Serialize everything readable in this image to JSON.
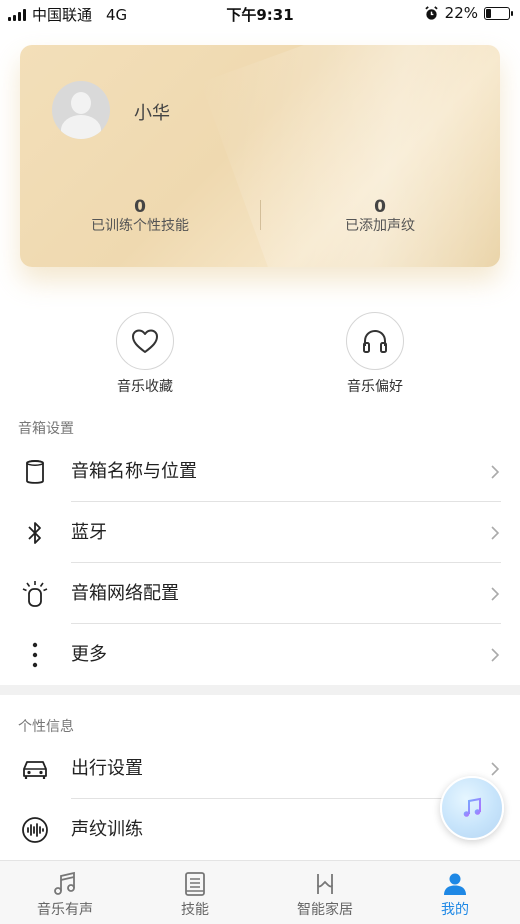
{
  "status_bar": {
    "carrier": "中国联通",
    "network": "4G",
    "time": "下午9:31",
    "battery": "22%",
    "battery_level": 0.22
  },
  "profile": {
    "name": "小华",
    "stats": [
      {
        "value": "0",
        "label": "已训练个性技能"
      },
      {
        "value": "0",
        "label": "已添加声纹"
      }
    ]
  },
  "quick_actions": [
    {
      "label": "音乐收藏",
      "icon": "heart-icon"
    },
    {
      "label": "音乐偏好",
      "icon": "headphones-icon"
    }
  ],
  "speaker_settings": {
    "title": "音箱设置",
    "items": [
      {
        "label": "音箱名称与位置",
        "icon": "speaker-icon"
      },
      {
        "label": "蓝牙",
        "icon": "bluetooth-icon"
      },
      {
        "label": "音箱网络配置",
        "icon": "network-config-icon"
      },
      {
        "label": "更多",
        "icon": "more-vertical-icon"
      }
    ]
  },
  "personal_info": {
    "title": "个性信息",
    "items": [
      {
        "label": "出行设置",
        "icon": "car-icon"
      },
      {
        "label": "声纹训练",
        "icon": "voiceprint-icon"
      }
    ]
  },
  "floating_button": {
    "icon": "music-note-icon"
  },
  "tabs": [
    {
      "label": "音乐有声",
      "icon": "music-note-icon",
      "active": false
    },
    {
      "label": "技能",
      "icon": "book-icon",
      "active": false
    },
    {
      "label": "智能家居",
      "icon": "smart-home-icon",
      "active": false
    },
    {
      "label": "我的",
      "icon": "person-icon",
      "active": true
    }
  ],
  "colors": {
    "accent": "#1e88e5",
    "card_gold": "#f0dab2"
  }
}
